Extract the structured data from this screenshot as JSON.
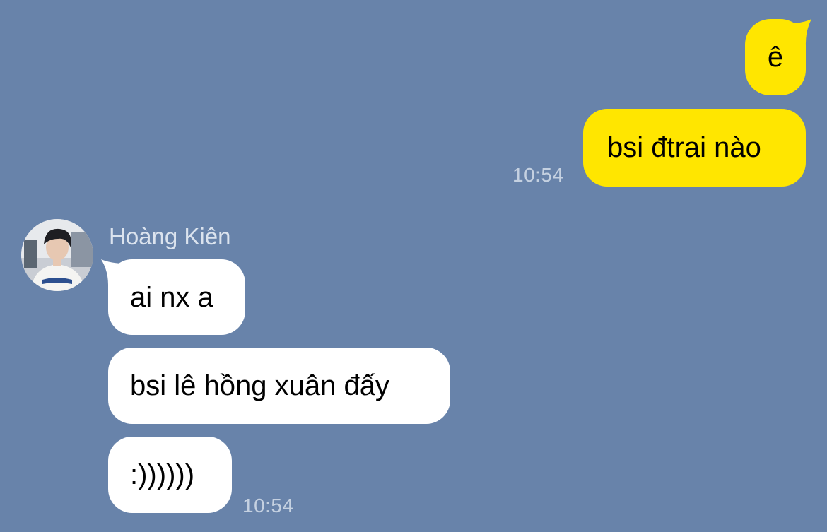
{
  "conversation": {
    "outgoing": [
      {
        "text": "ê"
      },
      {
        "text": "bsi đtrai nào",
        "time": "10:54"
      }
    ],
    "contact": {
      "name": "Hoàng Kiên",
      "avatar_icon": "profile-photo"
    },
    "incoming": [
      {
        "text": "ai nx a"
      },
      {
        "text": "bsi lê hồng xuân đấy"
      },
      {
        "text": ":))))))",
        "time": "10:54"
      }
    ]
  },
  "colors": {
    "background": "#6883aa",
    "outgoing_bubble": "#ffe600",
    "incoming_bubble": "#ffffff",
    "timestamp": "#c5d1e1"
  }
}
